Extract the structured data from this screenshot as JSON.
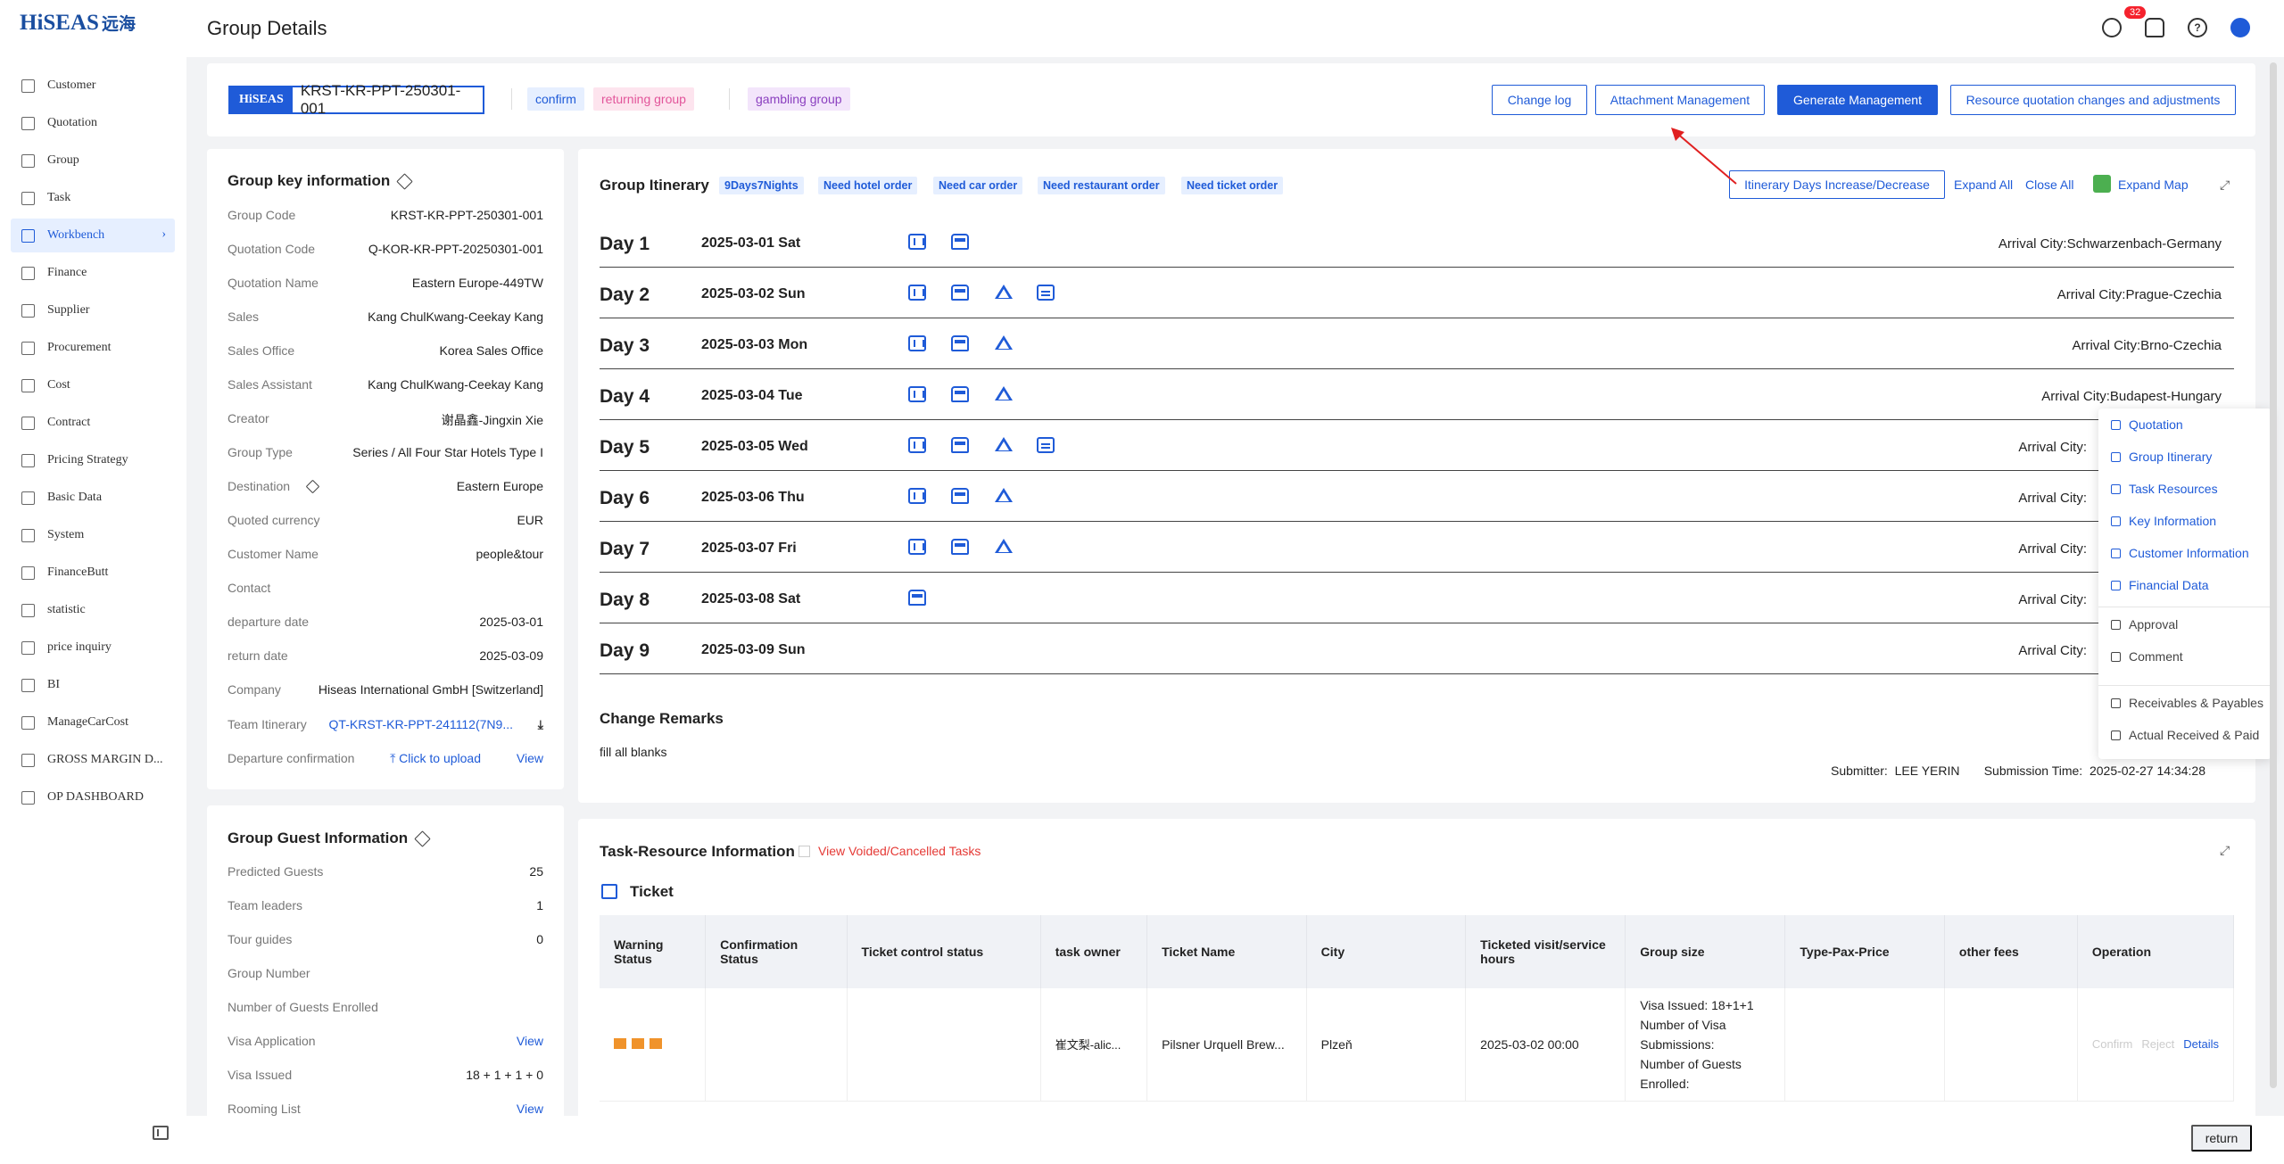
{
  "app": {
    "logo_text": "HiSEAS",
    "logo_cn": "远海"
  },
  "sidebar": {
    "items": [
      {
        "label": "Customer"
      },
      {
        "label": "Quotation"
      },
      {
        "label": "Group"
      },
      {
        "label": "Task"
      },
      {
        "label": "Workbench",
        "active": true
      },
      {
        "label": "Finance"
      },
      {
        "label": "Supplier"
      },
      {
        "label": "Procurement"
      },
      {
        "label": "Cost"
      },
      {
        "label": "Contract"
      },
      {
        "label": "Pricing Strategy"
      },
      {
        "label": "Basic Data"
      },
      {
        "label": "System"
      },
      {
        "label": "FinanceButt"
      },
      {
        "label": "statistic"
      },
      {
        "label": "price inquiry"
      },
      {
        "label": "BI"
      },
      {
        "label": "ManageCarCost"
      },
      {
        "label": "GROSS MARGIN D..."
      },
      {
        "label": "OP DASHBOARD"
      }
    ]
  },
  "header": {
    "title": "Group Details",
    "notification_count": "32"
  },
  "topbar": {
    "logo": "HiSEAS",
    "group_code": "KRST-KR-PPT-250301-001",
    "tags": [
      "confirm",
      "returning group",
      "gambling group"
    ],
    "buttons": {
      "change_log": "Change log",
      "attachment": "Attachment Management",
      "generate": "Generate Management",
      "resource_quote": "Resource quotation changes and adjustments"
    }
  },
  "key_info": {
    "title": "Group key information",
    "rows": [
      {
        "k": "Group Code",
        "v": "KRST-KR-PPT-250301-001"
      },
      {
        "k": "Quotation Code",
        "v": "Q-KOR-KR-PPT-20250301-001"
      },
      {
        "k": "Quotation Name",
        "v": "Eastern Europe-449TW"
      },
      {
        "k": "Sales",
        "v": "Kang ChulKwang-Ceekay Kang"
      },
      {
        "k": "Sales Office",
        "v": "Korea Sales Office"
      },
      {
        "k": "Sales Assistant",
        "v": "Kang ChulKwang-Ceekay Kang"
      },
      {
        "k": "Creator",
        "v": "谢晶鑫-Jingxin Xie"
      },
      {
        "k": "Group Type",
        "v": "Series  / All Four Star Hotels Type I"
      },
      {
        "k": "Destination",
        "v": "Eastern Europe"
      },
      {
        "k": "Quoted currency",
        "v": "EUR"
      },
      {
        "k": "Customer Name",
        "v": "people&tour"
      },
      {
        "k": "Contact",
        "v": ""
      },
      {
        "k": "departure date",
        "v": "2025-03-01"
      },
      {
        "k": "return date",
        "v": "2025-03-09"
      },
      {
        "k": "Company",
        "v": "Hiseas International GmbH [Switzerland]"
      }
    ],
    "team_itinerary_label": "Team Itinerary",
    "team_itinerary_value": "QT-KRST-KR-PPT-241112(7N9...",
    "departure_confirmation_label": "Departure confirmation",
    "upload_label": "Click to upload",
    "view_label": "View"
  },
  "guest_info": {
    "title": "Group Guest Information",
    "rows": [
      {
        "k": "Predicted Guests",
        "v": "25"
      },
      {
        "k": "Team leaders",
        "v": "1"
      },
      {
        "k": "Tour guides",
        "v": "0"
      },
      {
        "k": "Group Number",
        "v": ""
      },
      {
        "k": "Number of Guests Enrolled",
        "v": ""
      },
      {
        "k": "Visa Application",
        "v": "View"
      },
      {
        "k": "Visa Issued",
        "v": "18 + 1 + 1 + 0"
      },
      {
        "k": "Rooming List",
        "v": "View"
      }
    ]
  },
  "itinerary": {
    "title": "Group Itinerary",
    "tags": [
      "9Days7Nights",
      "Need hotel order",
      "Need car order",
      "Need restaurant order",
      "Need ticket order"
    ],
    "increase_btn": "Itinerary Days Increase/Decrease",
    "expand_all": "Expand All",
    "close_all": "Close All",
    "expand_map": "Expand Map",
    "arrival_label": "Arrival City:",
    "days": [
      {
        "day": "Day 1",
        "date": "2025-03-01 Sat",
        "icons": [
          "hotel",
          "bus"
        ],
        "city": "Schwarzenbach-Germany"
      },
      {
        "day": "Day 2",
        "date": "2025-03-02 Sun",
        "icons": [
          "hotel",
          "bus",
          "tent",
          "ticket"
        ],
        "city": "Prague-Czechia"
      },
      {
        "day": "Day 3",
        "date": "2025-03-03 Mon",
        "icons": [
          "hotel",
          "bus",
          "tent"
        ],
        "city": "Brno-Czechia"
      },
      {
        "day": "Day 4",
        "date": "2025-03-04 Tue",
        "icons": [
          "hotel",
          "bus",
          "tent"
        ],
        "city": "Budapest-Hungary"
      },
      {
        "day": "Day 5",
        "date": "2025-03-05 Wed",
        "icons": [
          "hotel",
          "bus",
          "tent",
          "ticket"
        ],
        "city": ""
      },
      {
        "day": "Day 6",
        "date": "2025-03-06 Thu",
        "icons": [
          "hotel",
          "bus",
          "tent"
        ],
        "city": ""
      },
      {
        "day": "Day 7",
        "date": "2025-03-07 Fri",
        "icons": [
          "hotel",
          "bus",
          "tent"
        ],
        "city": ""
      },
      {
        "day": "Day 8",
        "date": "2025-03-08 Sat",
        "icons": [
          "bus"
        ],
        "city": ""
      },
      {
        "day": "Day 9",
        "date": "2025-03-09 Sun",
        "icons": [],
        "city": ""
      }
    ],
    "remarks_title": "Change Remarks",
    "remarks_text": "fill all blanks",
    "submitter_label": "Submitter:",
    "submitter": "LEE YERIN",
    "submission_time_label": "Submission Time:",
    "submission_time": "2025-02-27 14:34:28"
  },
  "task_resource": {
    "title": "Task-Resource Information",
    "voided_label": "View Voided/Cancelled Tasks",
    "section": "Ticket",
    "columns": [
      "Warning Status",
      "Confirmation Status",
      "Ticket control status",
      "task owner",
      "Ticket Name",
      "City",
      "Ticketed visit/service hours",
      "Group size",
      "Type-Pax-Price",
      "other fees",
      "Operation"
    ],
    "row": {
      "task_owner": "崔文梨-alic...",
      "ticket_name": "Pilsner Urquell Brew...",
      "city": "Plzeň",
      "hours": "2025-03-02 00:00",
      "group_size": [
        "Visa Issued: 18+1+1",
        "Number of Visa Submissions:",
        "Number of Guests Enrolled:"
      ],
      "ops": [
        "Confirm",
        "Reject",
        "Details"
      ]
    }
  },
  "float_menu": {
    "blue_items": [
      "Quotation",
      "Group Itinerary",
      "Task Resources",
      "Key Information",
      "Customer Information",
      "Financial Data"
    ],
    "gray_items": [
      "Approval",
      "Comment"
    ],
    "fin_items": [
      "Receivables & Payables",
      "Actual Received & Paid"
    ]
  },
  "footer": {
    "return_label": "return"
  },
  "colors": {
    "primary": "#1f5bd8",
    "danger": "#f5222d"
  }
}
